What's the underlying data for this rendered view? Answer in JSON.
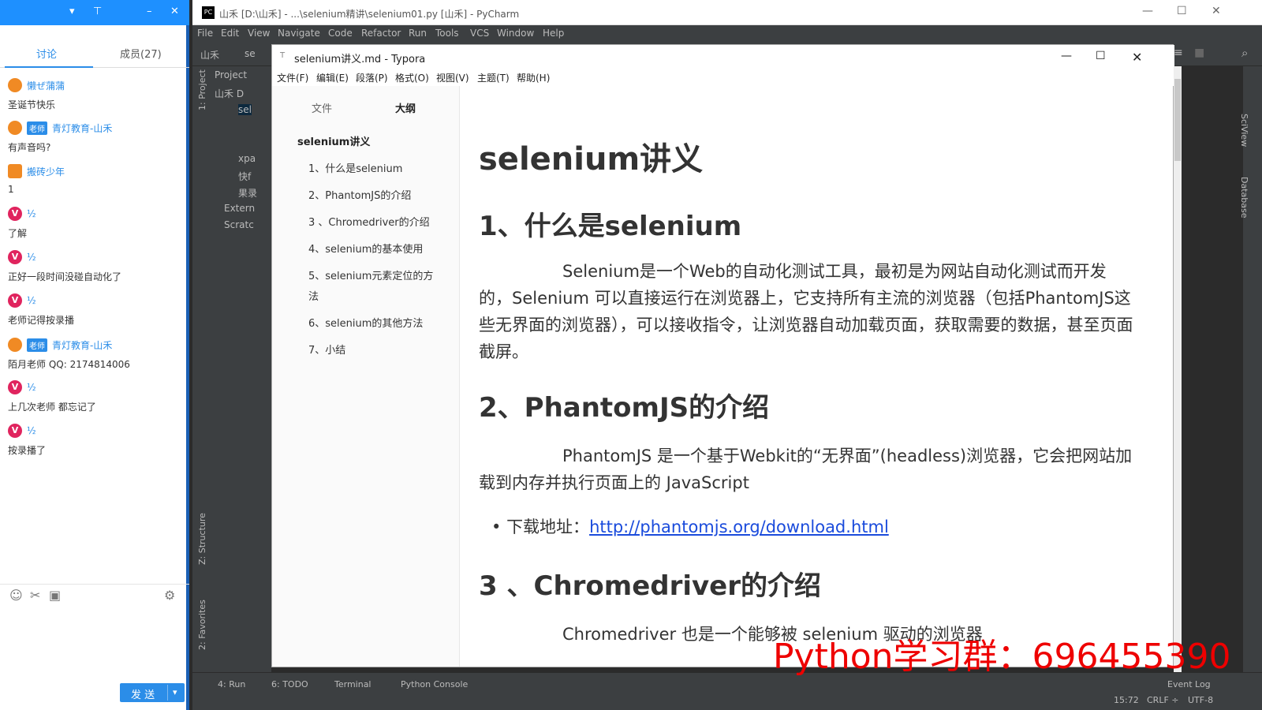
{
  "chat": {
    "tab_discussion": "讨论",
    "tab_members": "成员(27)",
    "messages": [
      {
        "user": "懒ぜ蒲蒲",
        "text": "圣诞节快乐"
      },
      {
        "badge": "老师",
        "user": "青灯教育-山禾",
        "text": "有声音吗?"
      },
      {
        "user": "搬砖少年",
        "text": "1"
      },
      {
        "avatar_letter": "V",
        "user": "½",
        "text": "了解"
      },
      {
        "avatar_letter": "V",
        "user": "½",
        "text": "正好一段时间没碰自动化了"
      },
      {
        "avatar_letter": "V",
        "user": "½",
        "text": "老师记得按录播"
      },
      {
        "badge": "老师",
        "user": "青灯教育-山禾",
        "text": "陌月老师 QQ: 2174814006"
      },
      {
        "avatar_letter": "V",
        "user": "½",
        "text": "上几次老师 都忘记了"
      },
      {
        "avatar_letter": "V",
        "user": "½",
        "text": "按录播了"
      }
    ],
    "send_label": "发 送",
    "send_arrow": "▾"
  },
  "pycharm": {
    "window_title": "山禾 [D:\\山禾] - ...\\selenium精讲\\selenium01.py [山禾] - PyCharm",
    "menu": [
      "File",
      "Edit",
      "View",
      "Navigate",
      "Code",
      "Refactor",
      "Run",
      "Tools",
      "VCS",
      "Window",
      "Help"
    ],
    "nav": [
      "山禾",
      "se"
    ],
    "project_label": "1: Project",
    "structure_label": "Z: Structure",
    "favorites_label": "2: Favorites",
    "tree": [
      "Project",
      "山禾 D",
      "sel",
      "xpa",
      "快f",
      "果录",
      "Extern",
      "Scratc"
    ],
    "right_labels": [
      "SciView",
      "Database"
    ],
    "bottom_tabs": [
      "4: Run",
      "6: TODO",
      "Terminal",
      "Python Console"
    ],
    "event_log": "Event Log",
    "status": {
      "position": "15:72",
      "line_sep": "CRLF ÷",
      "encoding": "UTF-8"
    }
  },
  "typora": {
    "window_title": "selenium讲义.md - Typora",
    "menu": [
      "文件(F)",
      "编辑(E)",
      "段落(P)",
      "格式(O)",
      "视图(V)",
      "主题(T)",
      "帮助(H)"
    ],
    "side_tabs": [
      "文件",
      "大纲"
    ],
    "toc_title": "selenium讲义",
    "toc": [
      "1、什么是selenium",
      "2、PhantomJS的介绍",
      "3 、Chromedriver的介绍",
      "4、selenium的基本使用",
      "5、selenium元素定位的方",
      "法",
      "6、selenium的其他方法",
      "7、小结"
    ],
    "doc": {
      "h1": "selenium讲义",
      "s1_title": "1、什么是selenium",
      "s1_body": "Selenium是一个Web的自动化测试工具，最初是为网站自动化测试而开发的，Selenium 可以直接运行在浏览器上，它支持所有主流的浏览器（包括PhantomJS这些无界面的浏览器），可以接收指令，让浏览器自动加载页面，获取需要的数据，甚至页面截屏。",
      "s2_title": "2、PhantomJS的介绍",
      "s2_body": "PhantomJS 是一个基于Webkit的“无界面”(headless)浏览器，它会把网站加载到内存并执行页面上的 JavaScript",
      "download_label": "下载地址：",
      "download_link": "http://phantomjs.org/download.html",
      "s3_title": "3 、Chromedriver的介绍",
      "s3_body_partial": "Chromedriver 也是一个能够被 selenium 驱动的浏览器"
    }
  },
  "watermark": "Python学习群：696455390"
}
